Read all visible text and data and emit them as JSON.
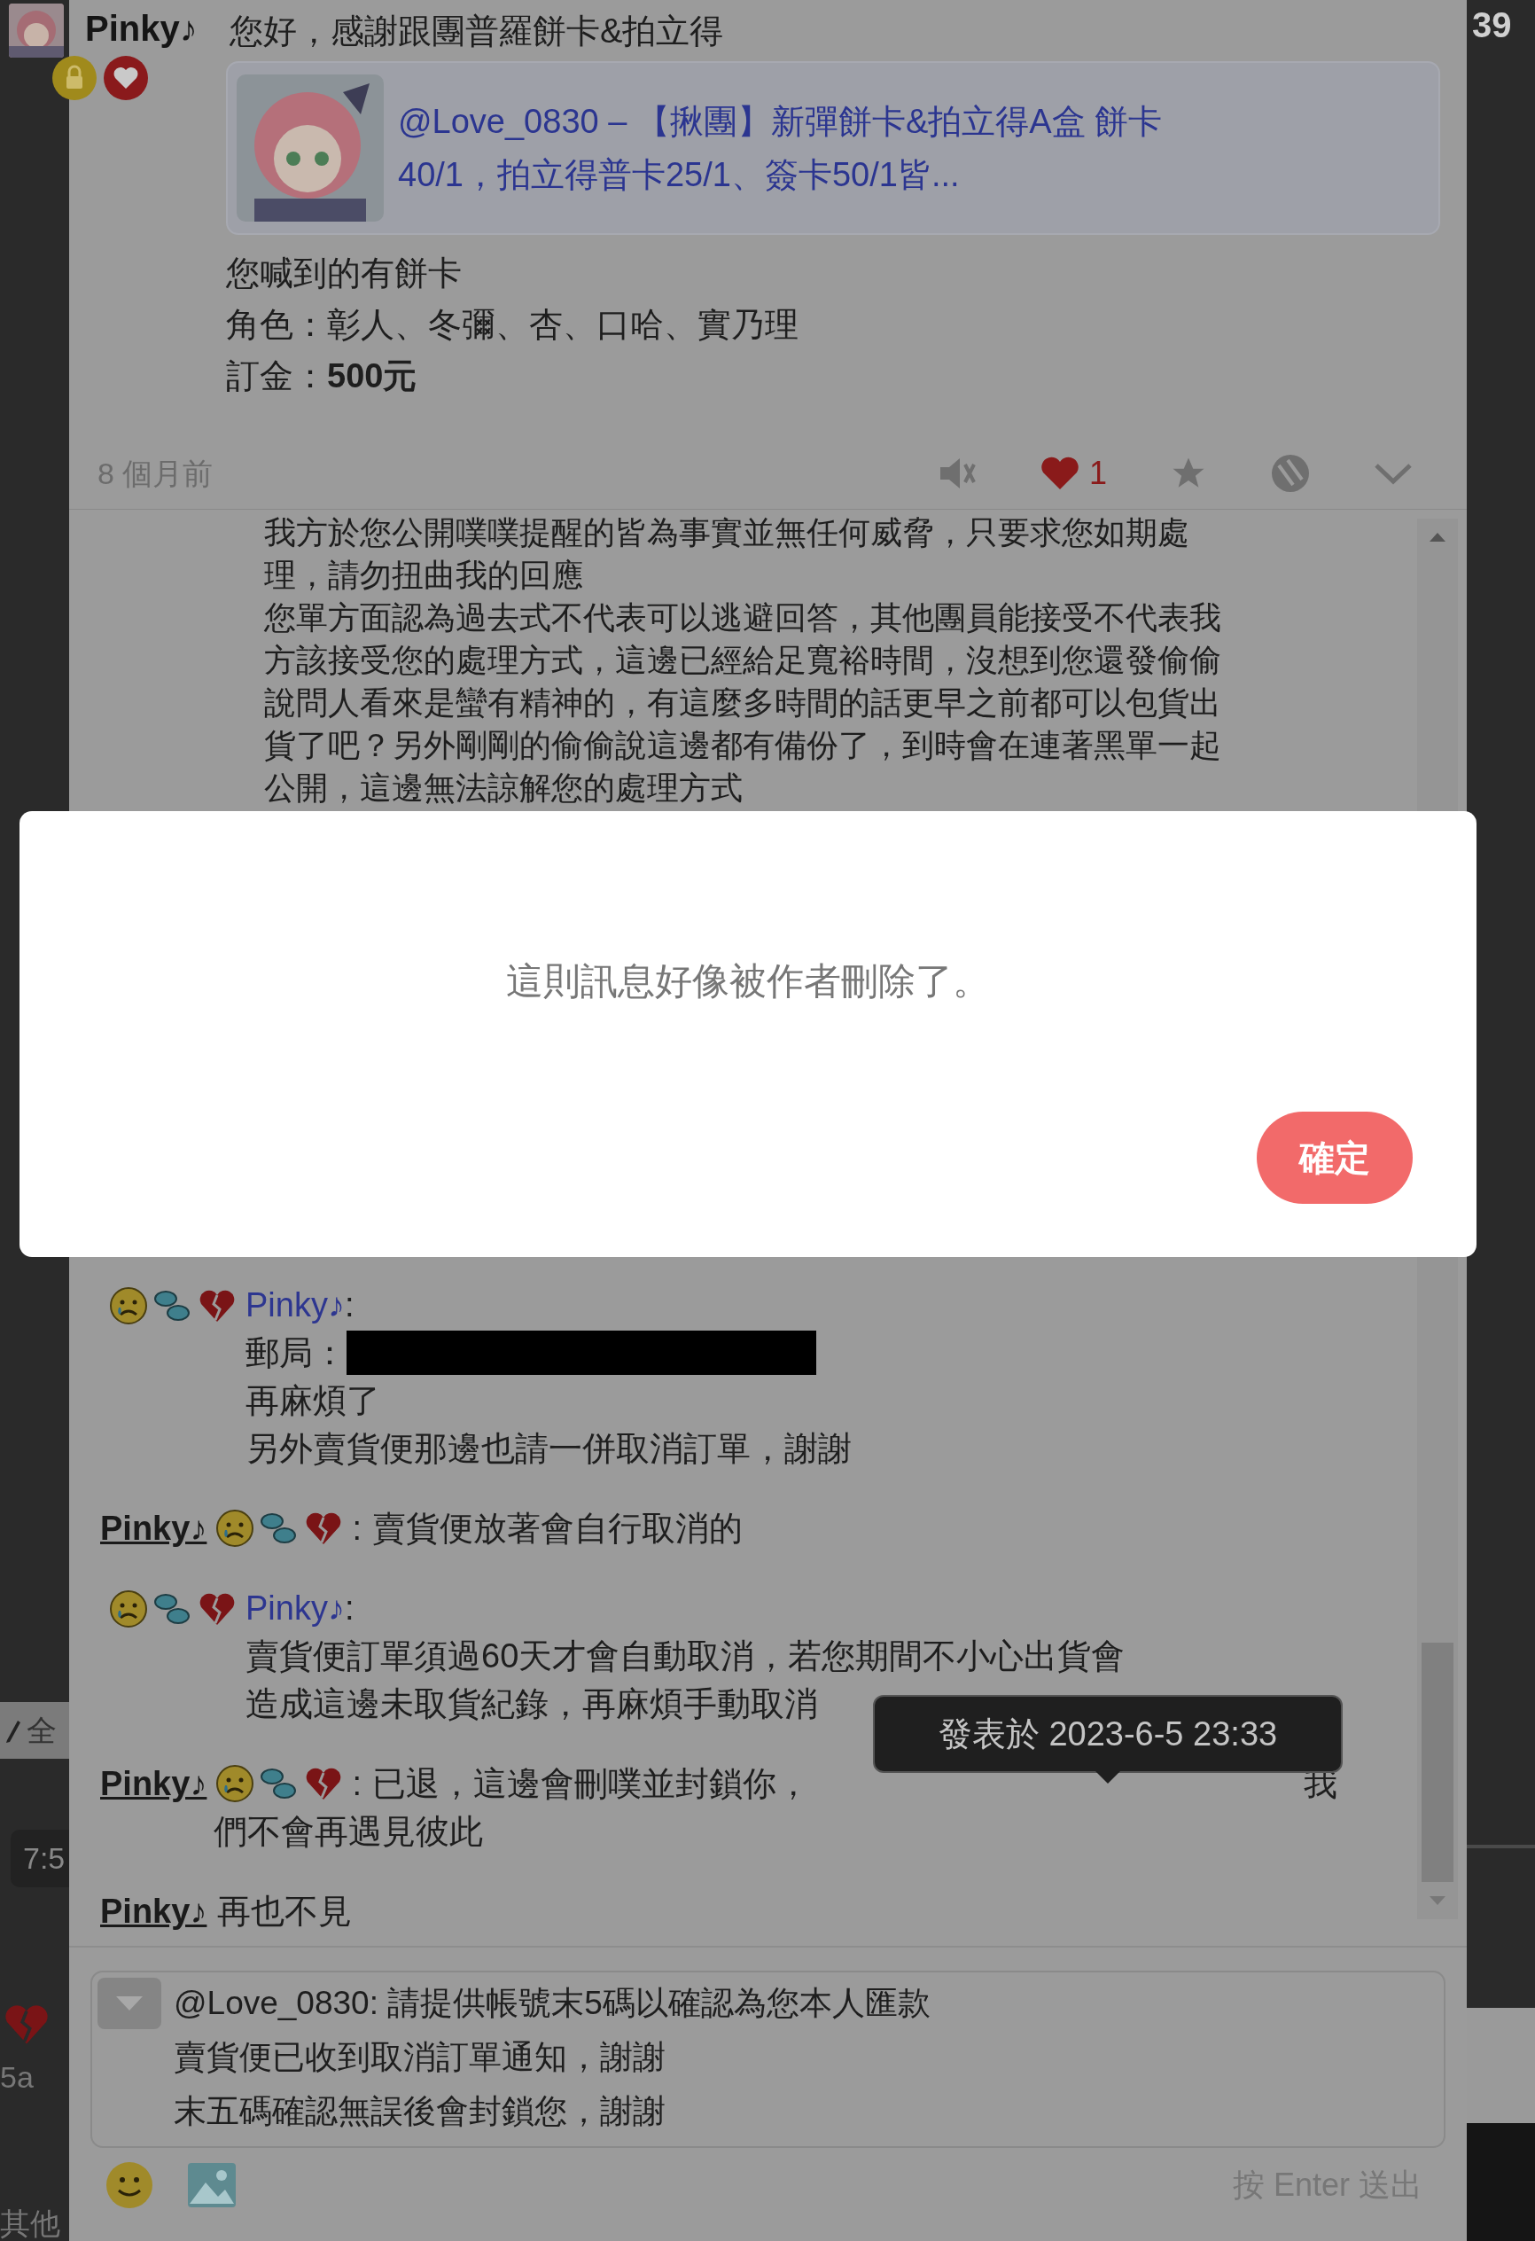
{
  "background": {
    "badge_count": "39",
    "fragments": [
      {
        "kind": "tab",
        "text": "全"
      },
      {
        "kind": "time",
        "text": "7:5"
      },
      {
        "kind": "label",
        "text": "5a"
      },
      {
        "kind": "label",
        "text": "其他"
      }
    ]
  },
  "post": {
    "author": "Pinky♪",
    "text": "您好，感謝跟團普羅餅卡&拍立得",
    "link_card": {
      "lines": [
        "@Love_0830 – 【揪團】新彈餅卡&拍立得A盒 餅卡",
        "40/1，拍立得普卡25/1、簽卡50/1皆..."
      ]
    },
    "lines": [
      "您喊到的有餅卡",
      "角色：彰人、冬彌、杏、口哈、實乃理",
      "訂金：**500元**"
    ],
    "time": "8 個月前",
    "likes": "1"
  },
  "responses": {
    "partial_lines": [
      "我方於您公開噗噗提醒的皆為事實並無任何威脅，只要求您如期處",
      "理，請勿扭曲我的回應",
      "您單方面認為過去式不代表可以逃避回答，其他團員能接受不代表我",
      "方該接受您的處理方式，這邊已經給足寬裕時間，沒想到您還發偷偷",
      "說問人看來是蠻有精神的，有這麼多時間的話更早之前都可以包貨出",
      "貨了吧？另外剛剛的偷偷說這邊都有備份了，到時會在連著黑單一起",
      "公開，這邊無法諒解您的處理方式"
    ],
    "items": [
      {
        "kind": "block",
        "author": "Pinky♪",
        "separator": ":",
        "lines": [
          {
            "text": "郵局：",
            "redacted": true
          },
          {
            "text": "再麻煩了",
            "redacted": false
          },
          {
            "text": "另外賣貨便那邊也請一併取消訂單，謝謝",
            "redacted": false
          }
        ]
      },
      {
        "kind": "inline",
        "author": "Pinky♪",
        "separator": ":",
        "emoji": true,
        "lines": [
          {
            "text": "賣貨便放著會自行取消的",
            "redacted": false
          }
        ]
      },
      {
        "kind": "block",
        "author": "Pinky♪",
        "separator": ":",
        "lines": [
          {
            "text": "賣貨便訂單須過60天才會自動取消，若您期間不小心出貨會",
            "redacted": false
          },
          {
            "text": "造成這邊未取貨紀錄，再麻煩手動取消",
            "redacted": false
          }
        ]
      },
      {
        "kind": "inline",
        "author": "Pinky♪",
        "separator": ":",
        "emoji": true,
        "lines": [
          {
            "text": "已退，這邊會刪噗並封鎖你，",
            "redacted": false
          },
          {
            "text": "們不會再遇見彼此",
            "redacted": false
          }
        ],
        "line_end": "我"
      },
      {
        "kind": "inline",
        "author": "Pinky♪",
        "emoji": false,
        "lines": [
          {
            "text": "再也不見",
            "redacted": false
          }
        ]
      }
    ]
  },
  "tooltip": "發表於 2023-6-5 23:33",
  "reply_box": {
    "lines": [
      "@Love_0830: 請提供帳號末5碼以確認為您本人匯款",
      "賣貨便已收到取消訂單通知，謝謝",
      "末五碼確認無誤後會封鎖您，謝謝"
    ],
    "hint": "按 Enter 送出"
  },
  "dialog": {
    "message": "這則訊息好像被作者刪除了。",
    "button": "確定"
  }
}
